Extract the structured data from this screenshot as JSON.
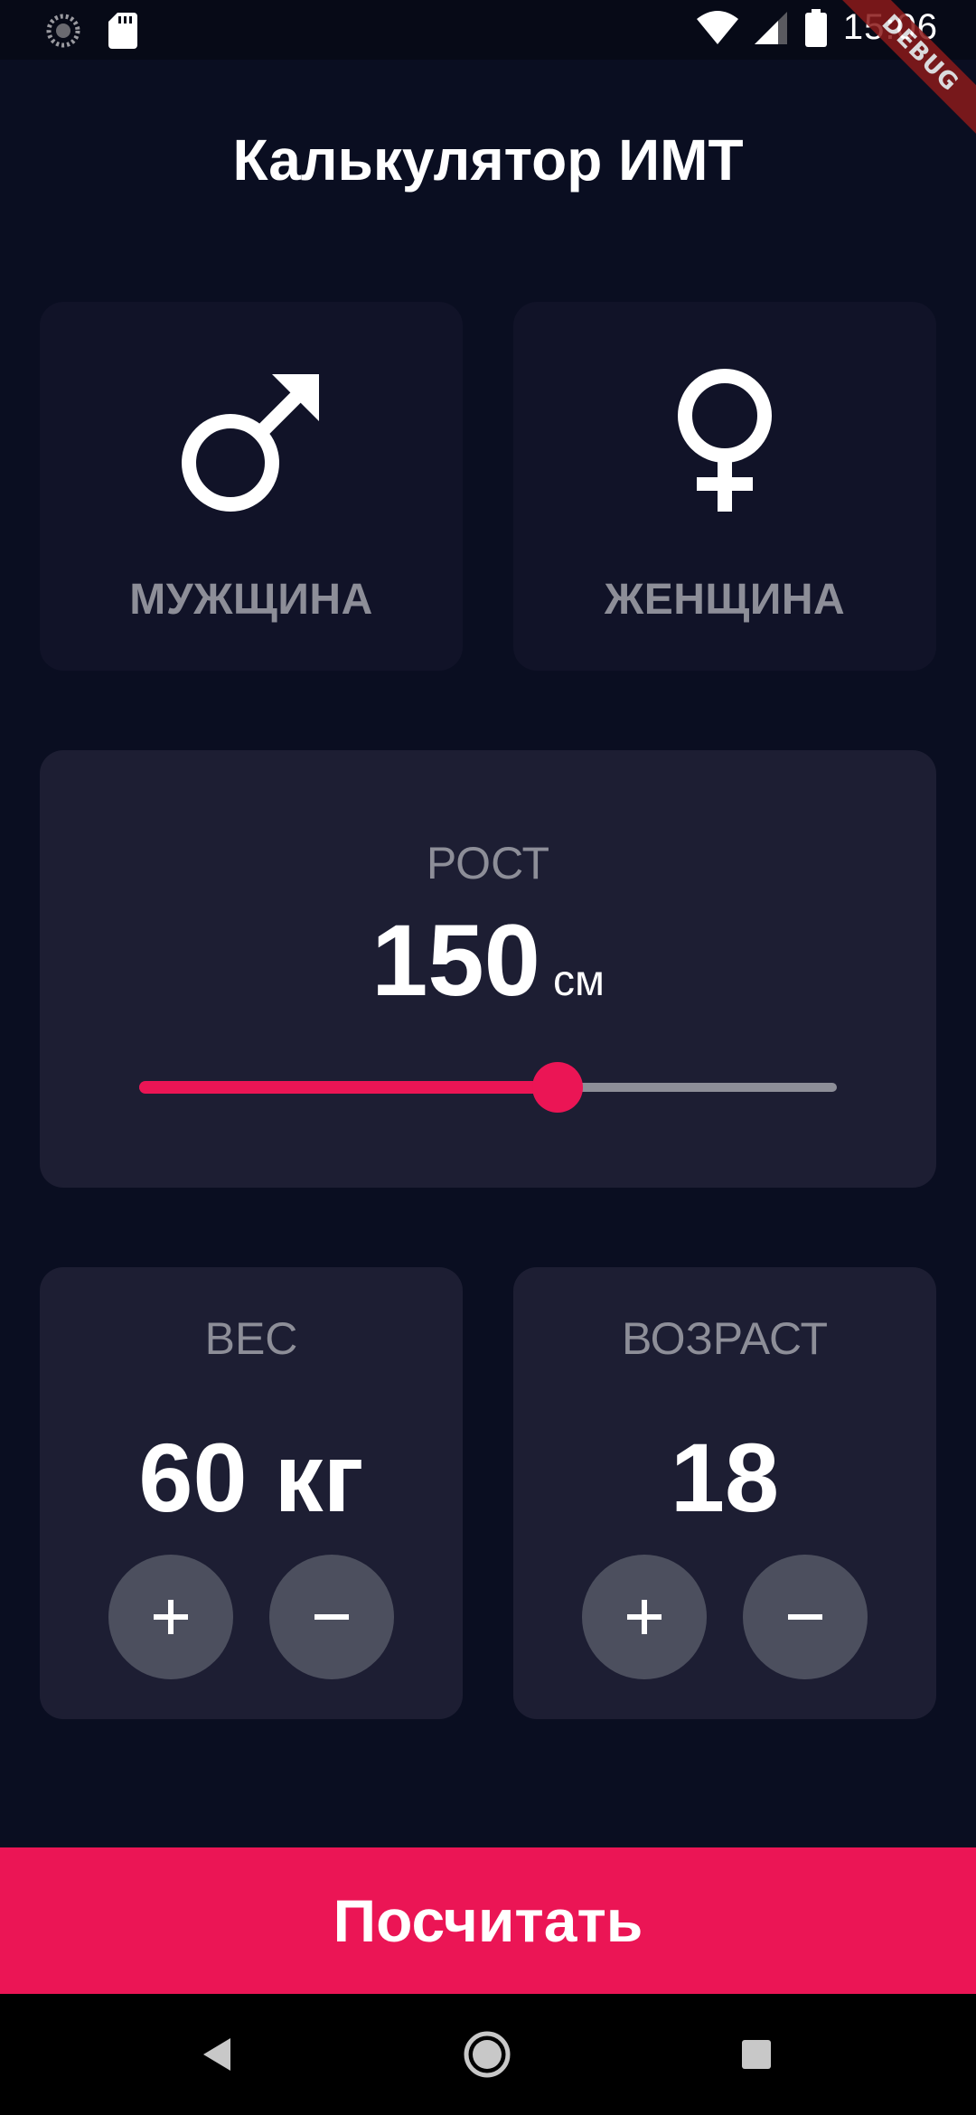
{
  "status_bar": {
    "time": "15:06",
    "debug_label": "DEBUG"
  },
  "header": {
    "title": "Калькулятор ИМТ"
  },
  "gender": {
    "male_label": "МУЖЩИНА",
    "female_label": "ЖЕНЩИНА",
    "male_icon": "male-symbol-icon",
    "female_icon": "female-symbol-icon"
  },
  "height": {
    "label": "РОСТ",
    "value": "150",
    "unit": "см",
    "slider_fraction": 0.6
  },
  "weight": {
    "label": "ВЕС",
    "value": "60 кг",
    "plus_label": "+",
    "minus_label": "−"
  },
  "age": {
    "label": "ВОЗРАСТ",
    "value": "18",
    "plus_label": "+",
    "minus_label": "−"
  },
  "calculate_button": {
    "label": "Посчитать"
  },
  "colors": {
    "background": "#0a0e21",
    "active_card": "#1d1e33",
    "inactive_card": "#111328",
    "accent": "#eb1555",
    "label_gray": "#8d8e98",
    "round_button": "#4c4f5e"
  },
  "nav_bar": {
    "icons": [
      "back-icon",
      "home-icon",
      "recents-icon"
    ]
  }
}
